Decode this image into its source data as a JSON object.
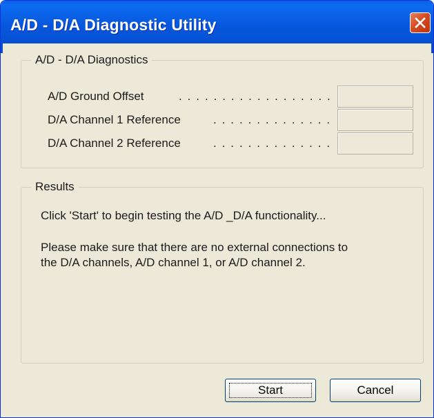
{
  "window": {
    "title": "A/D - D/A Diagnostic Utility",
    "close_icon": "close-icon",
    "colors": {
      "titlebar": "#0553d6",
      "close_button": "#d2481f",
      "client_background": "#ece9d8"
    }
  },
  "diagnostics": {
    "legend": "A/D - D/A Diagnostics",
    "rows": [
      {
        "label": "A/D Ground Offset",
        "dots": ". . . . . . . . . . . . . . . . . . . . .",
        "value": ""
      },
      {
        "label": "D/A Channel 1 Reference",
        "dots": ". . . . . . . . . . . . . . .",
        "value": ""
      },
      {
        "label": "D/A Channel 2 Reference",
        "dots": ". . . . . . . . . . . . . . .",
        "value": ""
      }
    ]
  },
  "results": {
    "legend": "Results",
    "line1": "Click 'Start' to begin testing the A/D _D/A functionality...",
    "line2": "Please make sure that there are no external connections to",
    "line3": "the D/A channels, A/D channel 1, or A/D channel 2."
  },
  "buttons": {
    "start": "Start",
    "cancel": "Cancel"
  }
}
